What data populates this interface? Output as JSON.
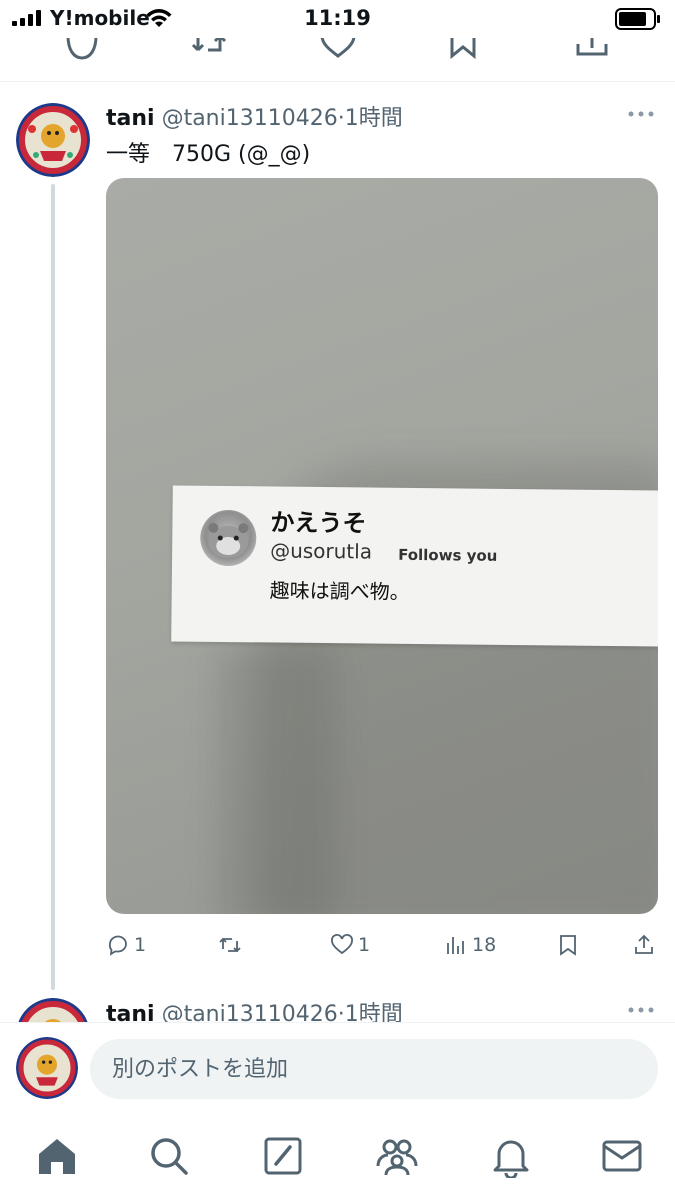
{
  "status_bar": {
    "carrier": "Y!mobile",
    "time": "11:19"
  },
  "tweet": {
    "name": "tani",
    "handle": "@tani13110426",
    "separator": "·",
    "time_ago": "1時間",
    "text": "一等　750G (@_@)",
    "photo": {
      "card_name": "かえうそ",
      "card_handle": "@usorutla",
      "card_follows": "Follows you",
      "card_bio": "趣味は調べ物。"
    },
    "actions": {
      "replies": "1",
      "retweets": "",
      "likes": "1",
      "views": "18"
    }
  },
  "tweet2": {
    "name": "tani",
    "handle": "@tani13110426",
    "separator": "·",
    "time_ago": "1時間"
  },
  "composer": {
    "placeholder": "別のポストを追加"
  },
  "colors": {
    "text_primary": "#0f1419",
    "text_secondary": "#536471",
    "thread_line": "#cfd9de",
    "input_bg": "#eff3f4"
  },
  "icons": {
    "nav": [
      "home-icon",
      "search-icon",
      "compose-icon",
      "communities-icon",
      "notifications-icon",
      "messages-icon"
    ]
  }
}
